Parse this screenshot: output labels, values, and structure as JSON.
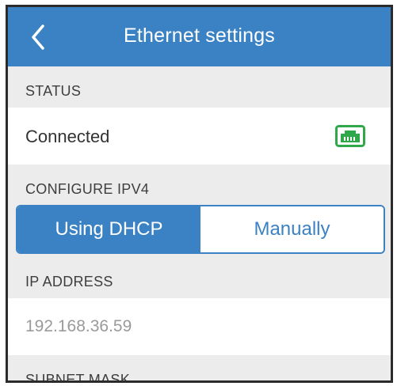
{
  "header": {
    "title": "Ethernet settings",
    "back_icon": "chevron-left-icon"
  },
  "status": {
    "section_label": "STATUS",
    "value": "Connected",
    "icon": "ethernet-port-icon",
    "icon_color": "#2fa84a"
  },
  "configure": {
    "section_label": "CONFIGURE IPV4",
    "options": [
      "Using DHCP",
      "Manually"
    ],
    "selected": "Using DHCP"
  },
  "ip_address": {
    "section_label": "IP ADDRESS",
    "value": "192.168.36.59"
  },
  "subnet_mask": {
    "section_label": "SUBNET MASK"
  },
  "colors": {
    "accent": "#3b82c4",
    "background": "#ececec"
  }
}
